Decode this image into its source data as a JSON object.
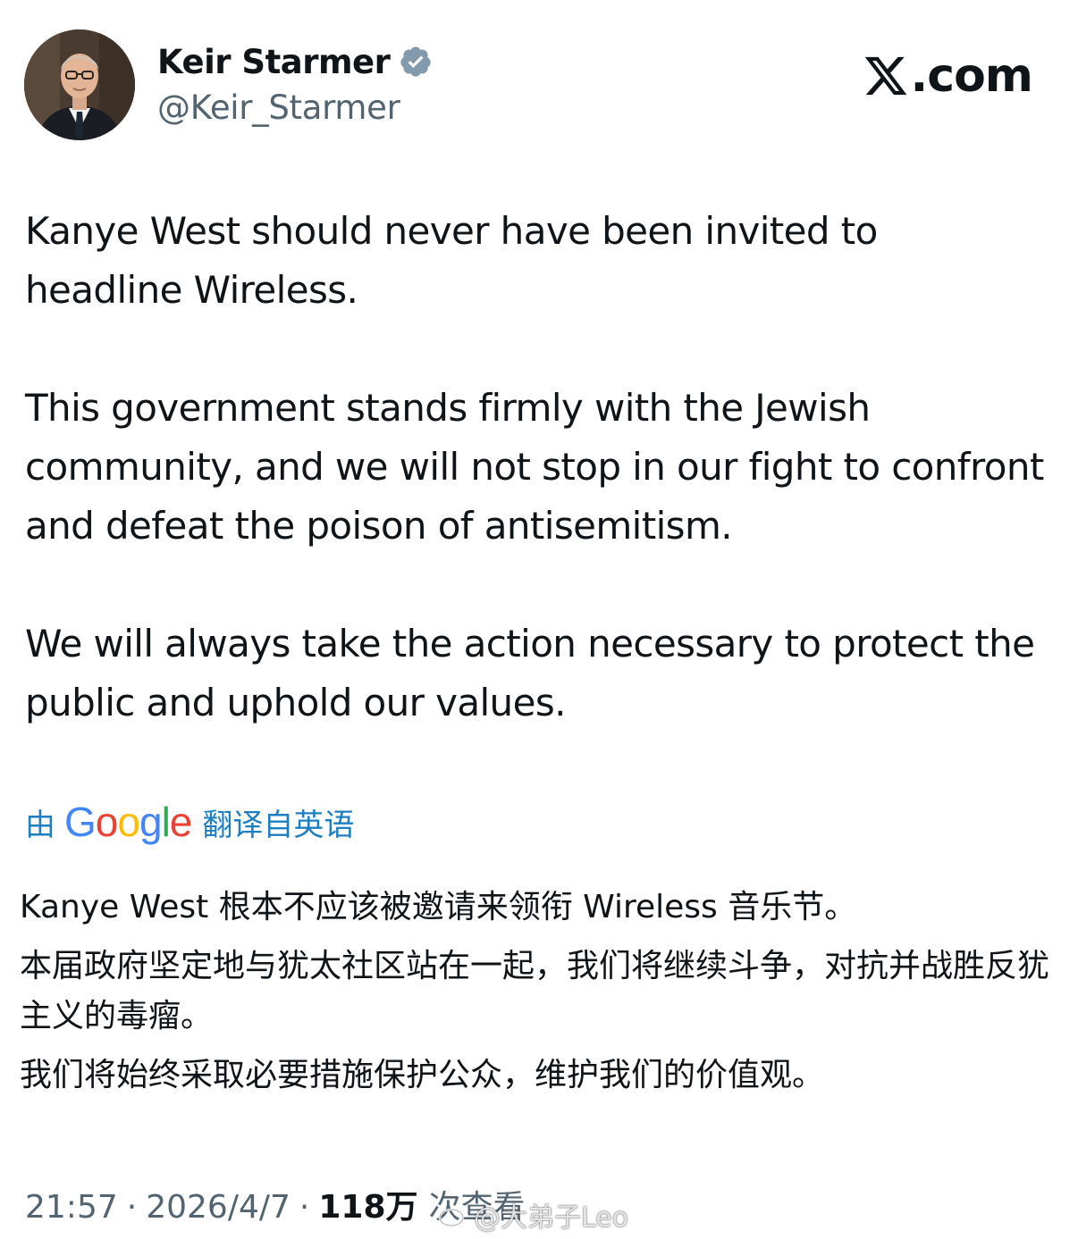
{
  "author": {
    "display_name": "Keir Starmer",
    "handle": "@Keir_Starmer",
    "verified": true,
    "verified_color": "#829aab"
  },
  "site": {
    "label": ".com"
  },
  "tweet": {
    "paragraphs": [
      "Kanye West should never have been invited to headline Wireless.",
      "This government stands firmly with the Jewish community, and we will not stop in our fight to confront and defeat the poison of antisemitism.",
      "We will always take the action necessary to protect the public and uphold our values."
    ]
  },
  "translation": {
    "prefix": "由",
    "provider": "Google",
    "suffix": "翻译自英语",
    "link_color": "#1d7ec2",
    "paragraphs": [
      "Kanye West 根本不应该被邀请来领衔 Wireless 音乐节。",
      "本届政府坚定地与犹太社区站在一起，我们将继续斗争，对抗并战胜反犹主义的毒瘤。",
      "我们将始终采取必要措施保护公众，维护我们的价值观。"
    ]
  },
  "meta": {
    "time": "21:57",
    "date": "2026/4/7",
    "separator": "·",
    "views": "118万",
    "views_label": "次查看"
  },
  "watermark": {
    "text": "@大弟子Leo",
    "icon": "weibo-icon"
  }
}
